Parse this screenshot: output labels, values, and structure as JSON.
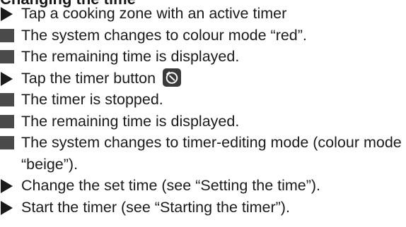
{
  "heading": "Changing the time",
  "items": [
    {
      "marker": "triangle",
      "text": "Tap a cooking zone with an active timer"
    },
    {
      "marker": "square",
      "text": "The system changes to colour mode “red”."
    },
    {
      "marker": "square",
      "text": "The remaining time is displayed."
    },
    {
      "marker": "triangle",
      "text": "Tap the timer button",
      "icon": "timer-button-icon"
    },
    {
      "marker": "square",
      "text": "The timer is stopped."
    },
    {
      "marker": "square",
      "text": "The remaining time is displayed."
    },
    {
      "marker": "square",
      "text": "The system changes to timer-editing mode (colour mode “beige”)."
    },
    {
      "marker": "triangle",
      "text": "Change the set time (see “Setting the time”)."
    },
    {
      "marker": "triangle",
      "text": "Start the timer (see “Starting the timer”)."
    }
  ]
}
